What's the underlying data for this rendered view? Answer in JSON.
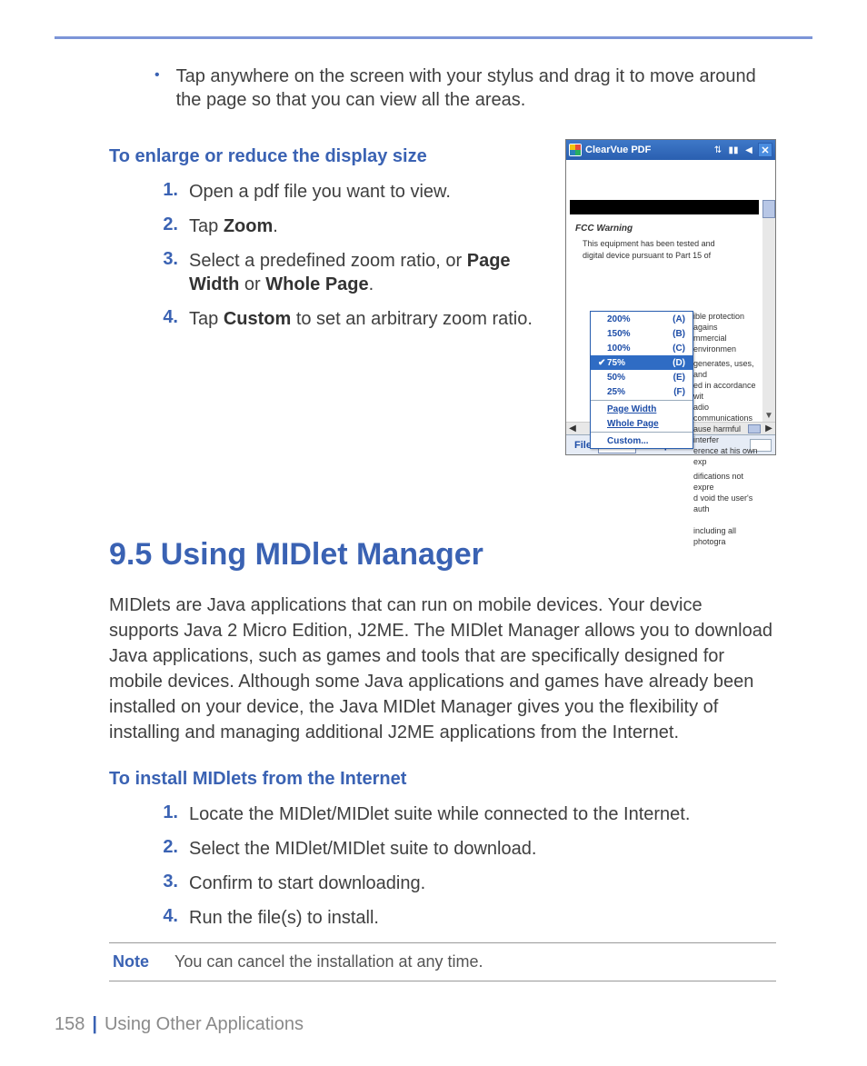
{
  "footer": {
    "page_number": "158",
    "separator": "|",
    "chapter": "Using Other Applications"
  },
  "bullet_top": {
    "text": "Tap anywhere on the screen with your stylus and drag it to move around the page so that you can view all the areas."
  },
  "section_zoom": {
    "heading": "To enlarge or reduce the display size",
    "steps": {
      "s1": {
        "num": "1.",
        "text": "Open a pdf file you want to view."
      },
      "s2": {
        "num": "2.",
        "pre": "Tap ",
        "bold": "Zoom",
        "post": "."
      },
      "s3": {
        "num": "3.",
        "pre": "Select a predefined zoom ratio, or ",
        "b1": "Page Width",
        "mid": " or ",
        "b2": "Whole Page",
        "post": "."
      },
      "s4": {
        "num": "4.",
        "pre": "Tap ",
        "bold": "Custom",
        "post": " to set an arbitrary zoom ratio."
      }
    }
  },
  "section_midlet": {
    "heading": "9.5  Using MIDlet Manager",
    "para": "MIDlets are Java applications that can run on mobile devices. Your device supports Java 2 Micro Edition, J2ME. The MIDlet Manager allows you to download Java applications, such as games and tools that are specifically designed for mobile devices. Although some Java applications and games have already been installed on your device, the Java MIDlet Manager gives you the flexibility of installing and managing additional J2ME applications from the Internet.",
    "sub_heading": "To install MIDlets from the Internet",
    "steps": {
      "s1": {
        "num": "1.",
        "text": "Locate the MIDlet/MIDlet suite while connected to the Internet."
      },
      "s2": {
        "num": "2.",
        "text": "Select the MIDlet/MIDlet suite to download."
      },
      "s3": {
        "num": "3.",
        "text": "Confirm to start downloading."
      },
      "s4": {
        "num": "4.",
        "text": "Run the file(s) to install."
      }
    },
    "note": {
      "label": "Note",
      "text": "You can cancel the installation at any time."
    }
  },
  "screenshot": {
    "title": "ClearVue PDF",
    "fcc_heading": "FCC Warning",
    "fcc_line1": "This equipment has been tested and",
    "fcc_line2": "digital device pursuant to Part 15 of",
    "menu": {
      "r1": {
        "label": "200%",
        "key": "(A)"
      },
      "r2": {
        "label": "150%",
        "key": "(B)"
      },
      "r3": {
        "label": "100%",
        "key": "(C)"
      },
      "r4": {
        "label": "75%",
        "key": "(D)"
      },
      "r5": {
        "label": "50%",
        "key": "(E)"
      },
      "r6": {
        "label": "25%",
        "key": "(F)"
      },
      "pw": "Page Width",
      "wp": "Whole Page",
      "cu": "Custom..."
    },
    "behind": {
      "l1": "ible protection agains",
      "l2": "mmercial environmen",
      "l3": "generates, uses, and",
      "l4": "ed in accordance wit",
      "l5": "adio communications",
      "l6": "ause harmful interfer",
      "l7": "erence at his own exp",
      "l8": "difications not expre",
      "l9": "d void the user's auth",
      "l10": "including all photogra"
    },
    "menubar": {
      "file": "File",
      "zoom": "Zoom",
      "setup": "Setup"
    }
  }
}
